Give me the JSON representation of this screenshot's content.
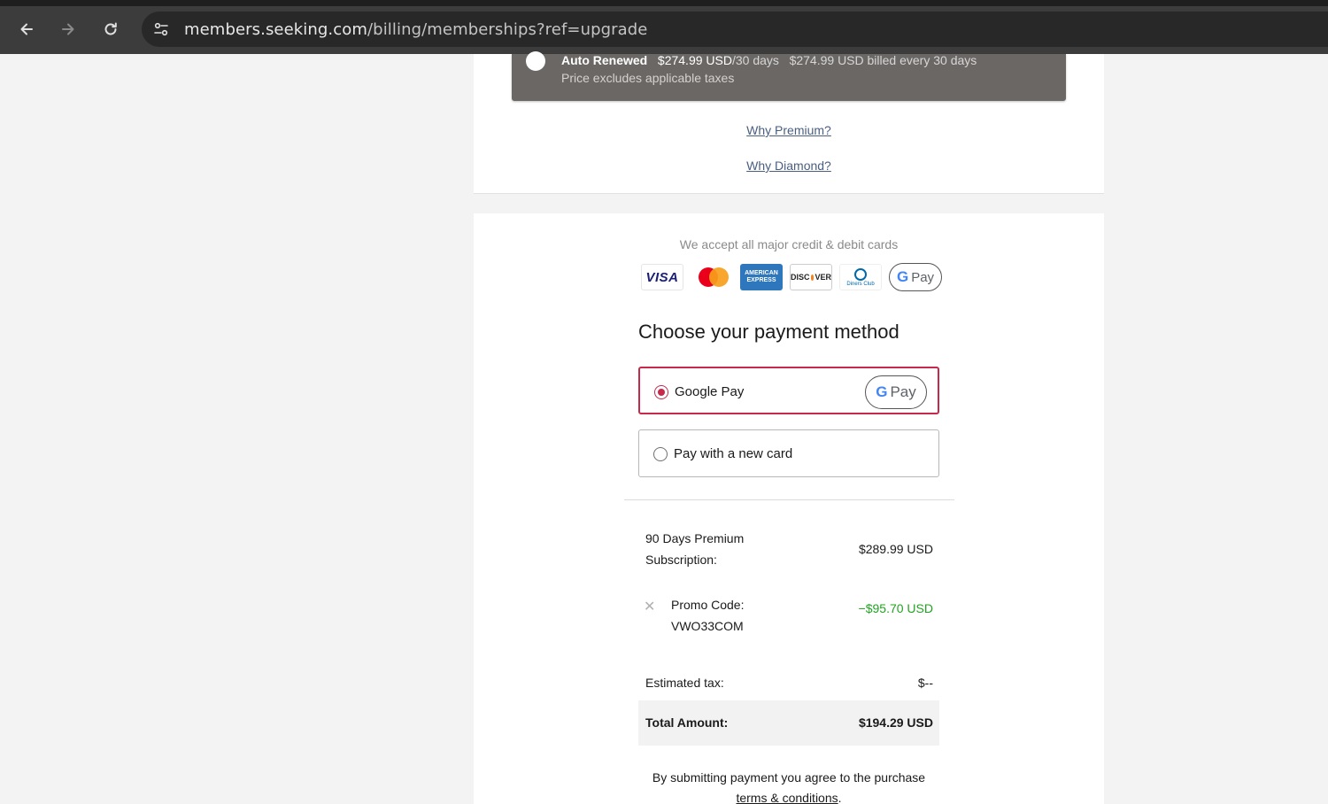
{
  "browser": {
    "url_host": "members.seeking.com",
    "url_path": "/billing/memberships?ref=upgrade"
  },
  "plan": {
    "renewal_label": "Auto Renewed",
    "price": "$274.99 USD",
    "period": "/30 days",
    "billing_note": "$274.99 USD billed every 30 days",
    "tax_note": "Price excludes applicable taxes"
  },
  "links": {
    "why_premium": "Why Premium?",
    "why_diamond": "Why Diamond?"
  },
  "payment": {
    "accept_text": "We accept all major credit & debit cards",
    "card_logos": [
      "VISA",
      "Mastercard",
      "American Express",
      "DISCOVER",
      "Diners Club",
      "G Pay"
    ],
    "title": "Choose your payment method",
    "options": [
      {
        "label": "Google Pay",
        "selected": true
      },
      {
        "label": "Pay with a new card",
        "selected": false
      }
    ],
    "gpay_text": "Pay"
  },
  "summary": {
    "subscription_label_line1": "90 Days Premium",
    "subscription_label_line2": "Subscription:",
    "subscription_value": "$289.99 USD",
    "promo_label": "Promo Code:",
    "promo_code": "VWO33COM",
    "promo_value": "−$95.70 USD",
    "tax_label": "Estimated tax:",
    "tax_value": "$--",
    "total_label": "Total Amount:",
    "total_value": "$194.29 USD"
  },
  "terms": {
    "text": "By submitting payment you agree to the purchase",
    "link": "terms & conditions",
    "suffix": "."
  },
  "colors": {
    "accent": "#c6294a",
    "discount": "#20a520",
    "link": "#4a5f80"
  }
}
